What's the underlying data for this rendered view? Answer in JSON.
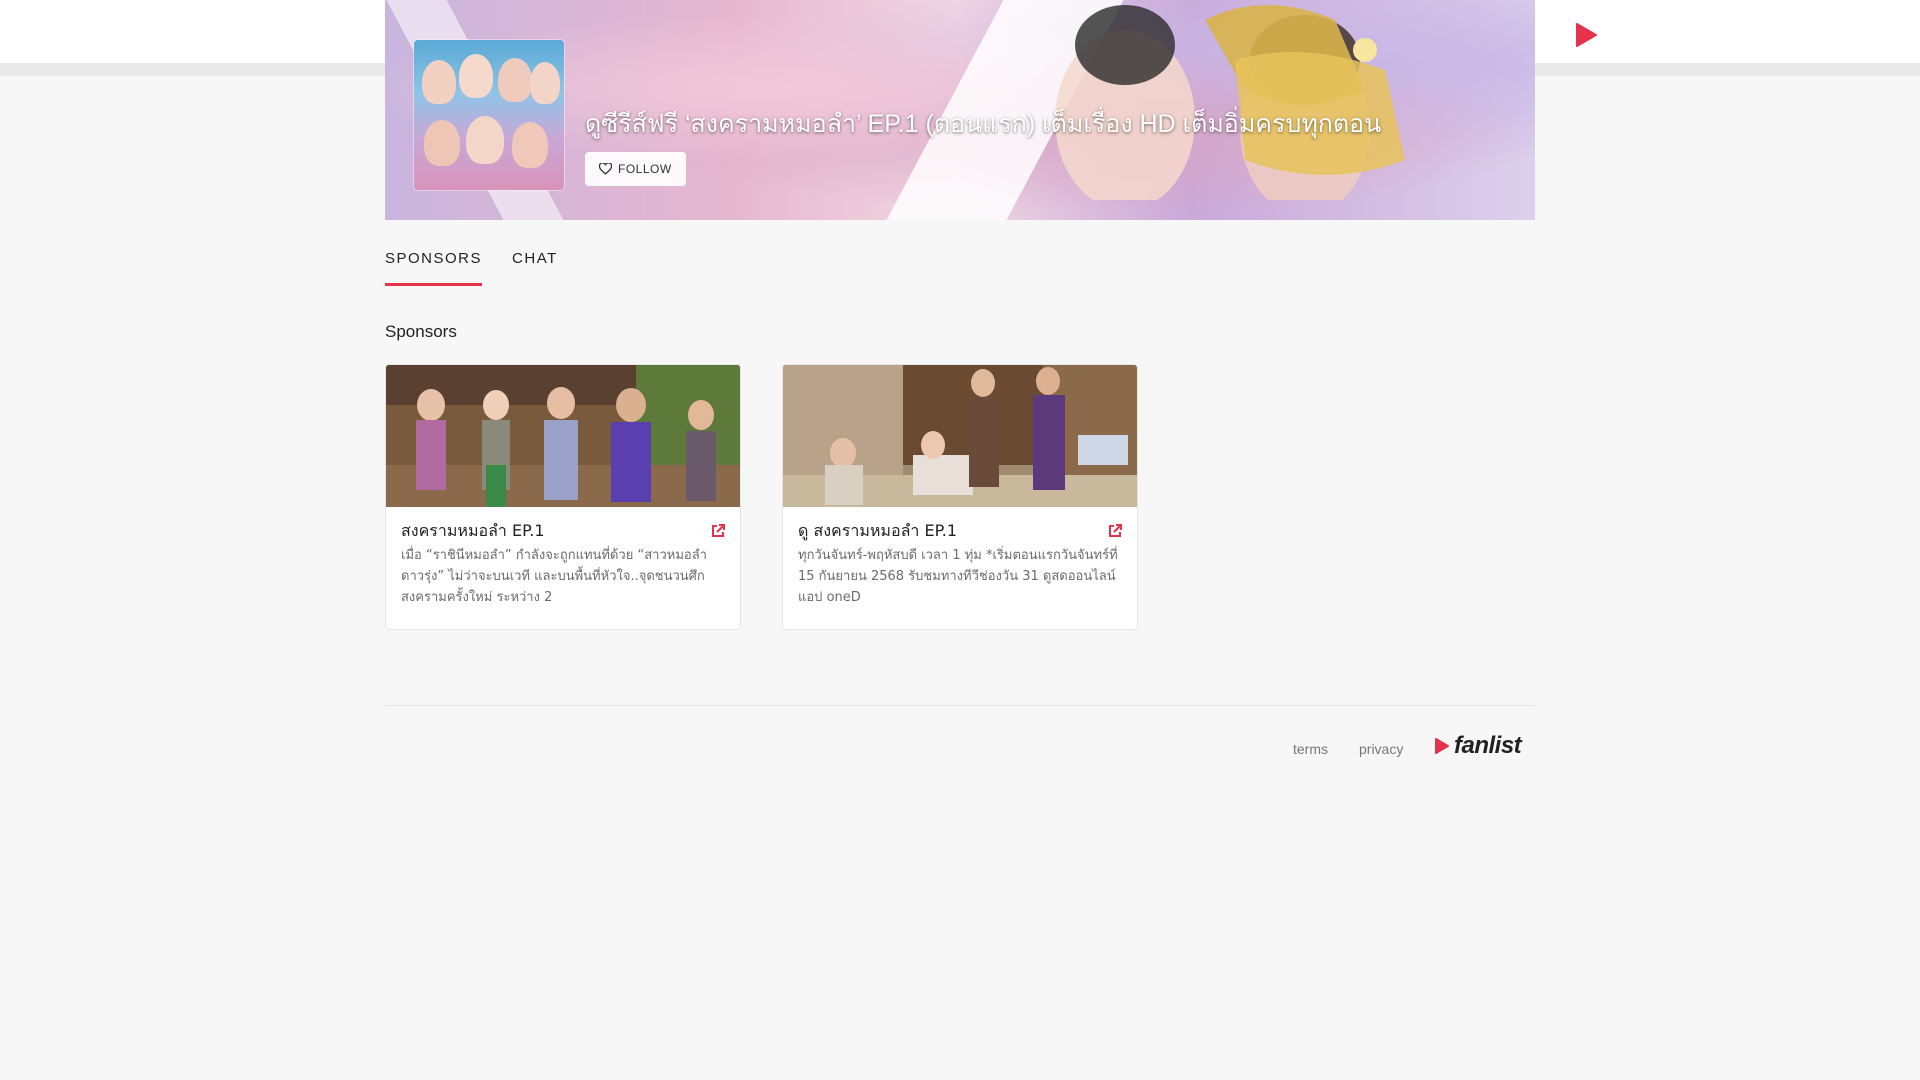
{
  "header": {
    "logo_icon": "play-icon",
    "accent_color": "#e4334a"
  },
  "banner": {
    "title": "ดูซีรีส์ฟรี ‘สงครามหมอลำ’ EP.1 (ตอนแรก) เต็มเรื่อง HD เต็มอิ่มครบทุกตอน",
    "follow_label": "FOLLOW",
    "follow_icon": "heart-icon"
  },
  "tabs": [
    {
      "label": "SPONSORS",
      "active": true
    },
    {
      "label": "CHAT",
      "active": false
    }
  ],
  "sponsors": {
    "heading": "Sponsors",
    "cards": [
      {
        "title": "สงครามหมอลำ EP.1",
        "description": "เมื่อ “ราชินีหมอลำ” กำลังจะถูกแทนที่ด้วย “สาวหมอลำดาวรุ่ง” ไม่ว่าจะบนเวที และบนพื้นที่หัวใจ..จุดชนวนศึกสงครามครั้งใหม่ ระหว่าง 2",
        "link_icon": "external-link-icon"
      },
      {
        "title": "ดู สงครามหมอลำ EP.1",
        "description": "ทุกวันจันทร์-พฤหัสบดี เวลา 1 ทุ่ม *เริ่มตอนแรกวันจันทร์ที่ 15 กันยายน 2568 รับชมทางทีวีช่องวัน 31 ดูสดออนไลน์ แอป oneD",
        "link_icon": "external-link-icon"
      }
    ]
  },
  "footer": {
    "terms_label": "terms",
    "privacy_label": "privacy",
    "brand_name": "fanlist"
  }
}
